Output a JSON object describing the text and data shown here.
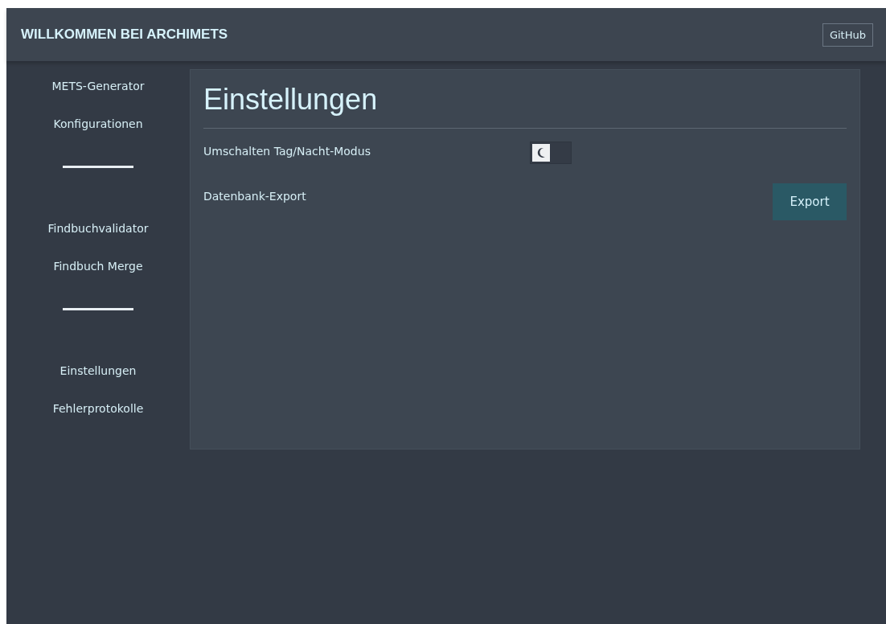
{
  "header": {
    "title": "WILLKOMMEN BEI ARCHIMETS",
    "github_button": "GitHub"
  },
  "sidebar": {
    "items": [
      {
        "kind": "link",
        "label": "METS-Generator"
      },
      {
        "kind": "link",
        "label": "Konfigurationen"
      },
      {
        "kind": "divider"
      },
      {
        "kind": "link",
        "label": "Findbuchvalidator"
      },
      {
        "kind": "link",
        "label": "Findbuch Merge"
      },
      {
        "kind": "divider"
      },
      {
        "kind": "link",
        "label": "Einstellungen"
      },
      {
        "kind": "link",
        "label": "Fehlerprotokolle"
      }
    ]
  },
  "settings": {
    "title": "Einstellungen",
    "rows": [
      {
        "kind": "toggle",
        "label": "Umschalten Tag/Nacht-Modus",
        "on": false
      },
      {
        "kind": "button",
        "label": "Datenbank-Export",
        "button": "Export"
      }
    ]
  }
}
